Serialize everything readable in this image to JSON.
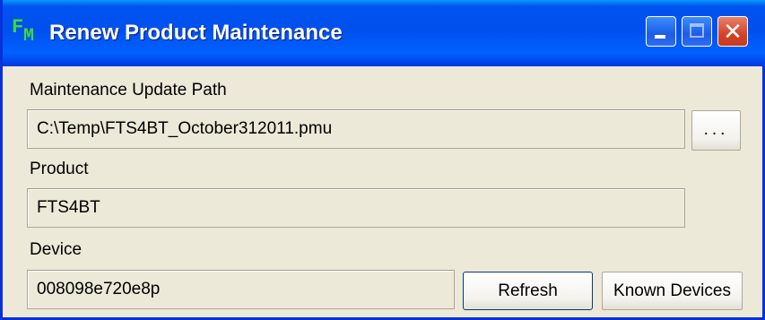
{
  "window": {
    "title": "Renew Product Maintenance",
    "app_icon": "fm-icon",
    "controls": {
      "minimize": "minimize-icon",
      "maximize": "maximize-icon",
      "close": "close-icon",
      "close_glyph": "✕"
    }
  },
  "form": {
    "path_label": "Maintenance Update Path",
    "path_value": "C:\\Temp\\FTS4BT_October312011.pmu",
    "browse_label": "...",
    "product_label": "Product",
    "product_value": "FTS4BT",
    "device_label": "Device",
    "device_value": "008098e720e8p",
    "refresh_label": "Refresh",
    "known_devices_label": "Known Devices"
  },
  "colors": {
    "titlebar": "#0054E3",
    "dialog_bg": "#ECE9D8",
    "close_button": "#D2442A",
    "app_icon": "#3BDB3B"
  }
}
